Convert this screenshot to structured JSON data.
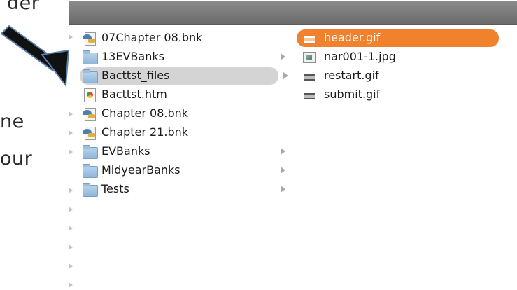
{
  "slide": {
    "fragments": [
      "der",
      "ne",
      "our"
    ]
  },
  "finder": {
    "col1": {
      "rows": [
        {
          "label": "07Chapter 08.bnk",
          "icon": "bank-file-icon",
          "has_children": false
        },
        {
          "label": "13EVBanks",
          "icon": "folder-icon",
          "has_children": true
        },
        {
          "label": "Bacttst_files",
          "icon": "folder-icon",
          "has_children": true,
          "selected": true
        },
        {
          "label": "Bacttst.htm",
          "icon": "html-file-icon",
          "has_children": false
        },
        {
          "label": "Chapter 08.bnk",
          "icon": "bank-file-icon",
          "has_children": false
        },
        {
          "label": "Chapter 21.bnk",
          "icon": "bank-file-icon",
          "has_children": false
        },
        {
          "label": "EVBanks",
          "icon": "folder-icon",
          "has_children": true
        },
        {
          "label": "MidyearBanks",
          "icon": "folder-icon",
          "has_children": true
        },
        {
          "label": "Tests",
          "icon": "folder-icon",
          "has_children": true
        }
      ]
    },
    "col2": {
      "rows": [
        {
          "label": "header.gif",
          "icon": "gif-file-icon",
          "selected": true
        },
        {
          "label": "nar001-1.jpg",
          "icon": "jpg-file-icon"
        },
        {
          "label": "restart.gif",
          "icon": "gif-file-icon"
        },
        {
          "label": "submit.gif",
          "icon": "gif-file-icon"
        }
      ]
    }
  },
  "colors": {
    "selection_accent": "#f0822e",
    "selection_inactive": "#d4d4d4",
    "arrow": "#111111"
  }
}
